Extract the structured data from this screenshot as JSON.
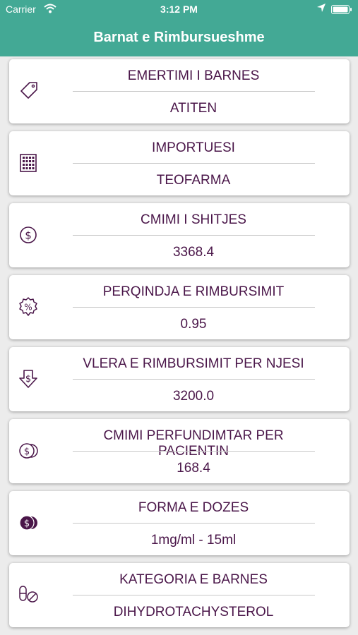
{
  "status_bar": {
    "carrier": "Carrier",
    "time": "3:12 PM"
  },
  "nav": {
    "title": "Barnat e Rimbursueshme"
  },
  "colors": {
    "header": "#43a995",
    "text": "#4a1649",
    "background": "#ececec"
  },
  "items": [
    {
      "icon": "tag-icon",
      "label": "EMERTIMI I BARNES",
      "value": "ATITEN"
    },
    {
      "icon": "grid-icon",
      "label": "IMPORTUESI",
      "value": "TEOFARMA"
    },
    {
      "icon": "dollar-circle-icon",
      "label": "CMIMI I SHITJES",
      "value": "3368.4"
    },
    {
      "icon": "percent-badge-icon",
      "label": "PERQINDJA E RIMBURSIMIT",
      "value": "0.95"
    },
    {
      "icon": "dollar-down-arrow-icon",
      "label": "VLERA E RIMBURSIMIT PER NJESI",
      "value": "3200.0"
    },
    {
      "icon": "coins-icon",
      "label": "CMIMI PERFUNDIMTAR PER PACIENTIN",
      "value": "168.4"
    },
    {
      "icon": "dollar-coins-filled-icon",
      "label": "FORMA E DOZES",
      "value": "1mg/ml - 15ml"
    },
    {
      "icon": "pills-icon",
      "label": "KATEGORIA E BARNES",
      "value": "DIHYDROTACHYSTEROL"
    }
  ]
}
